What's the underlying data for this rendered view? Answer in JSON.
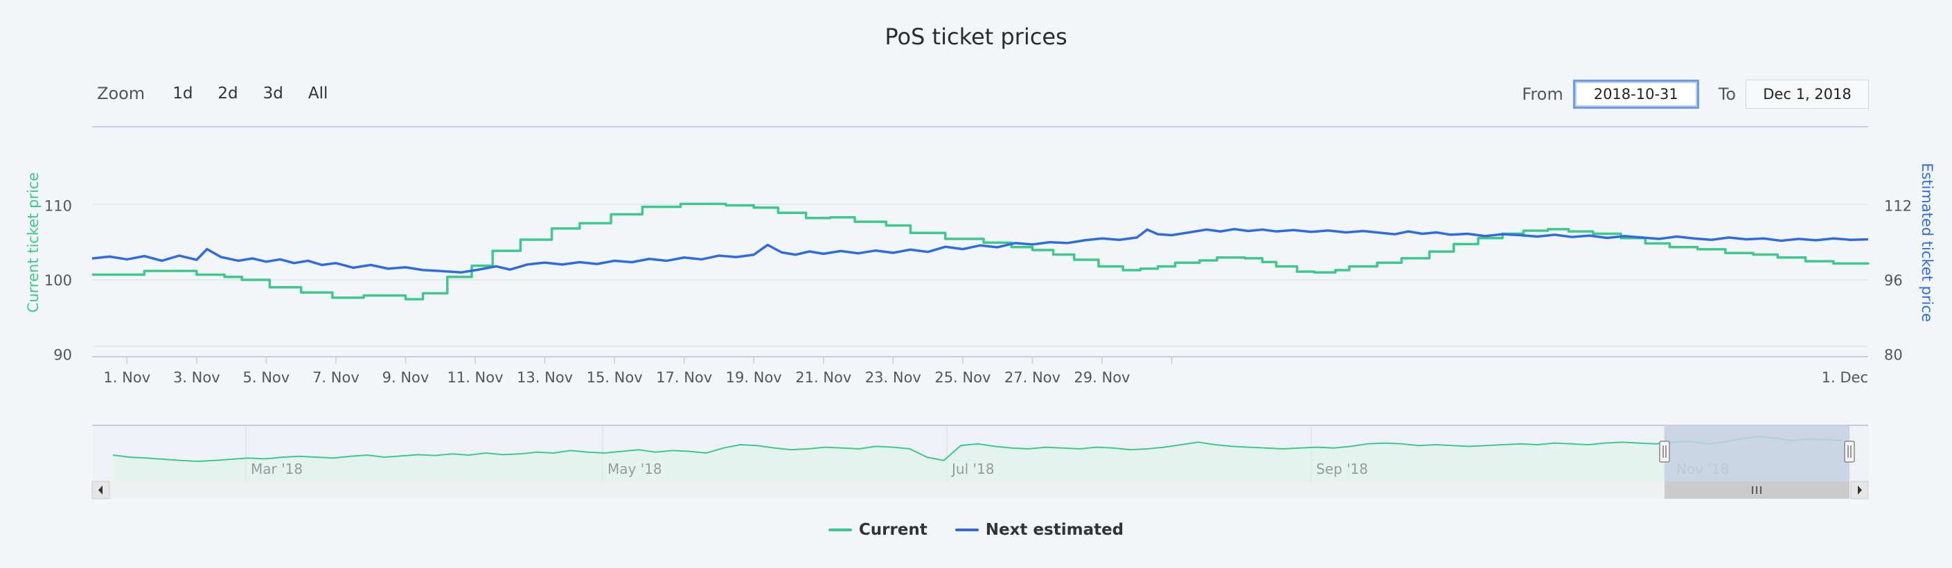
{
  "title": "PoS ticket prices",
  "zoom": {
    "label": "Zoom",
    "buttons": [
      "1d",
      "2d",
      "3d",
      "All"
    ]
  },
  "range": {
    "from_label": "From",
    "from_value": "2018-10-31",
    "to_label": "To",
    "to_value": "Dec 1, 2018"
  },
  "colors": {
    "current": "#3cc98b",
    "estimated": "#2f6be0",
    "navigator_fill": "#c4d0e3"
  },
  "chart_data": {
    "type": "line",
    "title": "PoS ticket prices",
    "x_unit": "days since 2018-10-31 (main chart)",
    "x_ticks": [
      "1. Nov",
      "3. Nov",
      "5. Nov",
      "7. Nov",
      "9. Nov",
      "11. Nov",
      "13. Nov",
      "15. Nov",
      "17. Nov",
      "19. Nov",
      "21. Nov",
      "23. Nov",
      "25. Nov",
      "27. Nov",
      "29. Nov",
      "1. Dec"
    ],
    "x_range": [
      "2018-10-31",
      "2018-12-01"
    ],
    "y_left": {
      "label": "Current ticket price",
      "ticks": [
        90,
        100,
        110
      ],
      "range": [
        90,
        110
      ]
    },
    "y_right": {
      "label": "Estimated ticket price",
      "ticks": [
        80,
        96,
        112
      ],
      "range": [
        80,
        112
      ]
    },
    "series": [
      {
        "name": "Current",
        "axis": "left",
        "points": [
          [
            0,
            100.7
          ],
          [
            1.5,
            101.2
          ],
          [
            3.0,
            100.7
          ],
          [
            3.8,
            100.4
          ],
          [
            4.3,
            100.0
          ],
          [
            5.1,
            99.0
          ],
          [
            6.0,
            98.3
          ],
          [
            6.9,
            97.6
          ],
          [
            7.8,
            97.9
          ],
          [
            9.0,
            97.4
          ],
          [
            9.5,
            98.2
          ],
          [
            10.2,
            100.4
          ],
          [
            10.9,
            101.9
          ],
          [
            11.5,
            103.9
          ],
          [
            12.3,
            105.4
          ],
          [
            13.2,
            106.9
          ],
          [
            14.0,
            107.6
          ],
          [
            14.9,
            108.8
          ],
          [
            15.8,
            109.8
          ],
          [
            16.9,
            110.2
          ],
          [
            18.2,
            110.0
          ],
          [
            19.0,
            109.7
          ],
          [
            19.7,
            109.0
          ],
          [
            20.5,
            108.3
          ],
          [
            21.2,
            108.4
          ],
          [
            21.9,
            107.8
          ],
          [
            22.8,
            107.3
          ],
          [
            23.5,
            106.3
          ],
          [
            24.5,
            105.5
          ],
          [
            25.6,
            105.0
          ],
          [
            26.4,
            104.4
          ],
          [
            27.0,
            104.0
          ],
          [
            27.6,
            103.4
          ],
          [
            28.2,
            102.7
          ],
          [
            28.9,
            101.8
          ],
          [
            29.6,
            101.3
          ],
          [
            30.1,
            101.5
          ],
          [
            30.6,
            101.8
          ],
          [
            31.1,
            102.3
          ],
          [
            31.8,
            102.6
          ],
          [
            32.3,
            103.0
          ],
          [
            33.1,
            102.9
          ],
          [
            33.6,
            102.4
          ],
          [
            34.0,
            101.8
          ],
          [
            34.6,
            101.1
          ],
          [
            35.1,
            101.0
          ],
          [
            35.7,
            101.3
          ],
          [
            36.1,
            101.8
          ],
          [
            36.9,
            102.3
          ],
          [
            37.6,
            102.9
          ],
          [
            38.4,
            103.8
          ],
          [
            39.1,
            104.8
          ],
          [
            39.8,
            105.6
          ],
          [
            40.5,
            106.2
          ],
          [
            41.1,
            106.6
          ],
          [
            41.8,
            106.8
          ],
          [
            42.4,
            106.5
          ],
          [
            43.1,
            106.2
          ],
          [
            43.9,
            105.6
          ],
          [
            44.6,
            104.9
          ],
          [
            45.3,
            104.4
          ],
          [
            46.1,
            104.1
          ],
          [
            46.9,
            103.6
          ],
          [
            47.7,
            103.4
          ],
          [
            48.4,
            103.0
          ],
          [
            49.2,
            102.5
          ],
          [
            50.0,
            102.2
          ],
          [
            51.0,
            102.3
          ]
        ]
      },
      {
        "name": "Next estimated",
        "axis": "right",
        "points": [
          [
            0,
            100.6
          ],
          [
            0.5,
            101.0
          ],
          [
            1.0,
            100.4
          ],
          [
            1.5,
            101.1
          ],
          [
            2.0,
            100.1
          ],
          [
            2.5,
            101.2
          ],
          [
            3.0,
            100.3
          ],
          [
            3.3,
            102.6
          ],
          [
            3.7,
            100.9
          ],
          [
            4.2,
            100.1
          ],
          [
            4.6,
            100.6
          ],
          [
            5.0,
            99.9
          ],
          [
            5.4,
            100.4
          ],
          [
            5.8,
            99.6
          ],
          [
            6.2,
            100.1
          ],
          [
            6.6,
            99.2
          ],
          [
            7.0,
            99.6
          ],
          [
            7.5,
            98.6
          ],
          [
            8.0,
            99.2
          ],
          [
            8.5,
            98.4
          ],
          [
            9.0,
            98.7
          ],
          [
            9.5,
            98.1
          ],
          [
            10.0,
            97.9
          ],
          [
            10.6,
            97.6
          ],
          [
            11.1,
            98.2
          ],
          [
            11.6,
            98.9
          ],
          [
            12.0,
            98.2
          ],
          [
            12.5,
            99.3
          ],
          [
            13.0,
            99.7
          ],
          [
            13.5,
            99.3
          ],
          [
            14.0,
            99.8
          ],
          [
            14.5,
            99.4
          ],
          [
            15.0,
            100.1
          ],
          [
            15.5,
            99.8
          ],
          [
            16.0,
            100.5
          ],
          [
            16.5,
            100.1
          ],
          [
            17.0,
            100.8
          ],
          [
            17.5,
            100.4
          ],
          [
            18.0,
            101.2
          ],
          [
            18.5,
            100.9
          ],
          [
            19.0,
            101.4
          ],
          [
            19.4,
            103.5
          ],
          [
            19.8,
            101.9
          ],
          [
            20.2,
            101.4
          ],
          [
            20.6,
            102.1
          ],
          [
            21.0,
            101.6
          ],
          [
            21.5,
            102.2
          ],
          [
            22.0,
            101.7
          ],
          [
            22.5,
            102.3
          ],
          [
            23.0,
            101.8
          ],
          [
            23.5,
            102.5
          ],
          [
            24.0,
            102.0
          ],
          [
            24.5,
            103.1
          ],
          [
            25.0,
            102.6
          ],
          [
            25.5,
            103.4
          ],
          [
            26.0,
            103.0
          ],
          [
            26.5,
            103.9
          ],
          [
            27.0,
            103.6
          ],
          [
            27.5,
            104.1
          ],
          [
            28.0,
            103.9
          ],
          [
            28.5,
            104.5
          ],
          [
            29.0,
            104.9
          ],
          [
            29.5,
            104.6
          ],
          [
            30.0,
            105.1
          ],
          [
            30.3,
            106.8
          ],
          [
            30.6,
            105.8
          ],
          [
            31.0,
            105.6
          ],
          [
            31.5,
            106.2
          ],
          [
            32.0,
            106.8
          ],
          [
            32.4,
            106.4
          ],
          [
            32.8,
            106.9
          ],
          [
            33.2,
            106.5
          ],
          [
            33.6,
            106.8
          ],
          [
            34.0,
            106.4
          ],
          [
            34.5,
            106.7
          ],
          [
            35.0,
            106.3
          ],
          [
            35.5,
            106.6
          ],
          [
            36.0,
            106.2
          ],
          [
            36.5,
            106.5
          ],
          [
            37.0,
            106.1
          ],
          [
            37.4,
            105.8
          ],
          [
            37.8,
            106.4
          ],
          [
            38.2,
            105.9
          ],
          [
            38.6,
            106.2
          ],
          [
            39.0,
            105.7
          ],
          [
            39.5,
            105.9
          ],
          [
            40.0,
            105.4
          ],
          [
            40.5,
            105.8
          ],
          [
            41.0,
            105.6
          ],
          [
            41.5,
            105.3
          ],
          [
            42.0,
            105.7
          ],
          [
            42.5,
            105.2
          ],
          [
            43.0,
            105.5
          ],
          [
            43.5,
            105.0
          ],
          [
            44.0,
            105.4
          ],
          [
            44.5,
            105.1
          ],
          [
            45.0,
            104.8
          ],
          [
            45.5,
            105.3
          ],
          [
            46.0,
            104.9
          ],
          [
            46.5,
            104.6
          ],
          [
            47.0,
            105.1
          ],
          [
            47.5,
            104.7
          ],
          [
            48.0,
            104.9
          ],
          [
            48.5,
            104.4
          ],
          [
            49.0,
            104.8
          ],
          [
            49.5,
            104.5
          ],
          [
            50.0,
            104.9
          ],
          [
            50.5,
            104.6
          ],
          [
            51.0,
            104.7
          ]
        ]
      }
    ],
    "legend": {
      "position": "bottom-center",
      "entries": [
        "Current",
        "Next estimated"
      ]
    },
    "grid": true
  },
  "navigator": {
    "labels": [
      "Mar '18",
      "May '18",
      "Jul '18",
      "Sep '18",
      "Nov '18"
    ],
    "profile": [
      0.55,
      0.5,
      0.48,
      0.45,
      0.42,
      0.4,
      0.42,
      0.45,
      0.48,
      0.46,
      0.5,
      0.52,
      0.5,
      0.48,
      0.52,
      0.55,
      0.5,
      0.53,
      0.56,
      0.54,
      0.58,
      0.55,
      0.6,
      0.56,
      0.58,
      0.62,
      0.6,
      0.66,
      0.62,
      0.6,
      0.64,
      0.68,
      0.62,
      0.66,
      0.64,
      0.6,
      0.72,
      0.8,
      0.78,
      0.72,
      0.68,
      0.7,
      0.74,
      0.72,
      0.7,
      0.76,
      0.74,
      0.7,
      0.5,
      0.42,
      0.78,
      0.82,
      0.76,
      0.72,
      0.7,
      0.74,
      0.72,
      0.7,
      0.74,
      0.72,
      0.68,
      0.7,
      0.74,
      0.8,
      0.86,
      0.8,
      0.76,
      0.74,
      0.72,
      0.7,
      0.72,
      0.74,
      0.72,
      0.76,
      0.82,
      0.84,
      0.82,
      0.78,
      0.8,
      0.78,
      0.76,
      0.78,
      0.8,
      0.82,
      0.8,
      0.84,
      0.82,
      0.8,
      0.84,
      0.86,
      0.84,
      0.82,
      0.86,
      0.88,
      0.82,
      0.86,
      0.94,
      1.0,
      0.96,
      0.9,
      0.94,
      0.92,
      0.9
    ]
  },
  "legend": {
    "items": [
      {
        "label": "Current",
        "color": "#3cc98b"
      },
      {
        "label": "Next estimated",
        "color": "#2f6be0"
      }
    ]
  }
}
